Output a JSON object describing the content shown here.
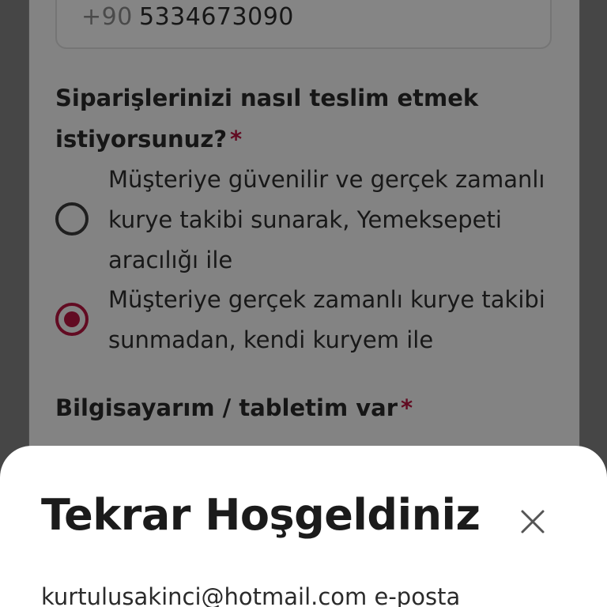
{
  "phone": {
    "country_code": "+90",
    "number": "5334673090"
  },
  "delivery_question": {
    "label": "Siparişlerinizi nasıl teslim etmek istiyorsunuz?",
    "required_mark": "*",
    "options": [
      {
        "label": "Müşteriye güvenilir ve gerçek zamanlı kurye takibi sunarak, Yemeksepeti aracılığı ile",
        "selected": false
      },
      {
        "label": "Müşteriye gerçek zamanlı kurye takibi sunmadan, kendi kuryem ile",
        "selected": true
      }
    ]
  },
  "device_question": {
    "label": "Bilgisayarım / tabletim var",
    "required_mark": "*"
  },
  "modal": {
    "title": "Tekrar Hoşgeldiniz",
    "close_icon": "close-icon",
    "email_text": "kurtulusakinci@hotmail.com e-posta"
  },
  "colors": {
    "accent": "#b5163f",
    "overlay": "rgba(0,0,0,0.46)"
  }
}
